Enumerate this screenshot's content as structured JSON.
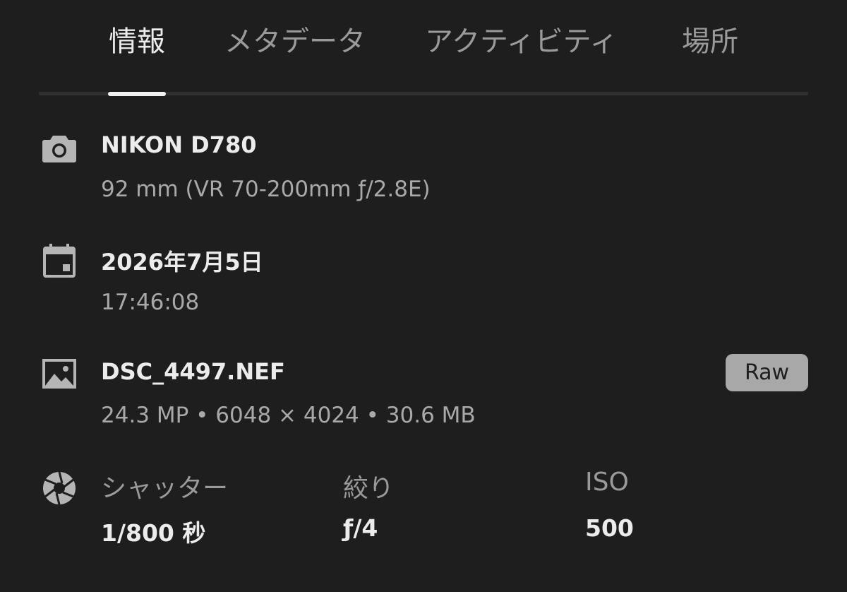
{
  "tabs": [
    {
      "label": "情報",
      "active": true
    },
    {
      "label": "メタデータ",
      "active": false
    },
    {
      "label": "アクティビティ",
      "active": false
    },
    {
      "label": "場所",
      "active": false
    }
  ],
  "camera": {
    "icon": "camera-icon",
    "model": "NIKON D780",
    "lens": "92 mm (VR 70-200mm ƒ/2.8E)"
  },
  "date": {
    "icon": "calendar-icon",
    "date": "2026年7月5日",
    "time": "17:46:08"
  },
  "file": {
    "icon": "image-icon",
    "name": "DSC_4497.NEF",
    "details": "24.3 MP • 6048 × 4024 • 30.6 MB",
    "badge": "Raw"
  },
  "exposure": {
    "icon": "aperture-icon",
    "shutter_label": "シャッター",
    "shutter_value": "1/800 秒",
    "aperture_label": "絞り",
    "aperture_value": "ƒ/4",
    "iso_label": "ISO",
    "iso_value": "500"
  },
  "colors": {
    "background": "#1e1e1e",
    "primary_text": "#ececec",
    "secondary_text": "#a9a9a9",
    "badge_bg": "#a8a8a8"
  }
}
